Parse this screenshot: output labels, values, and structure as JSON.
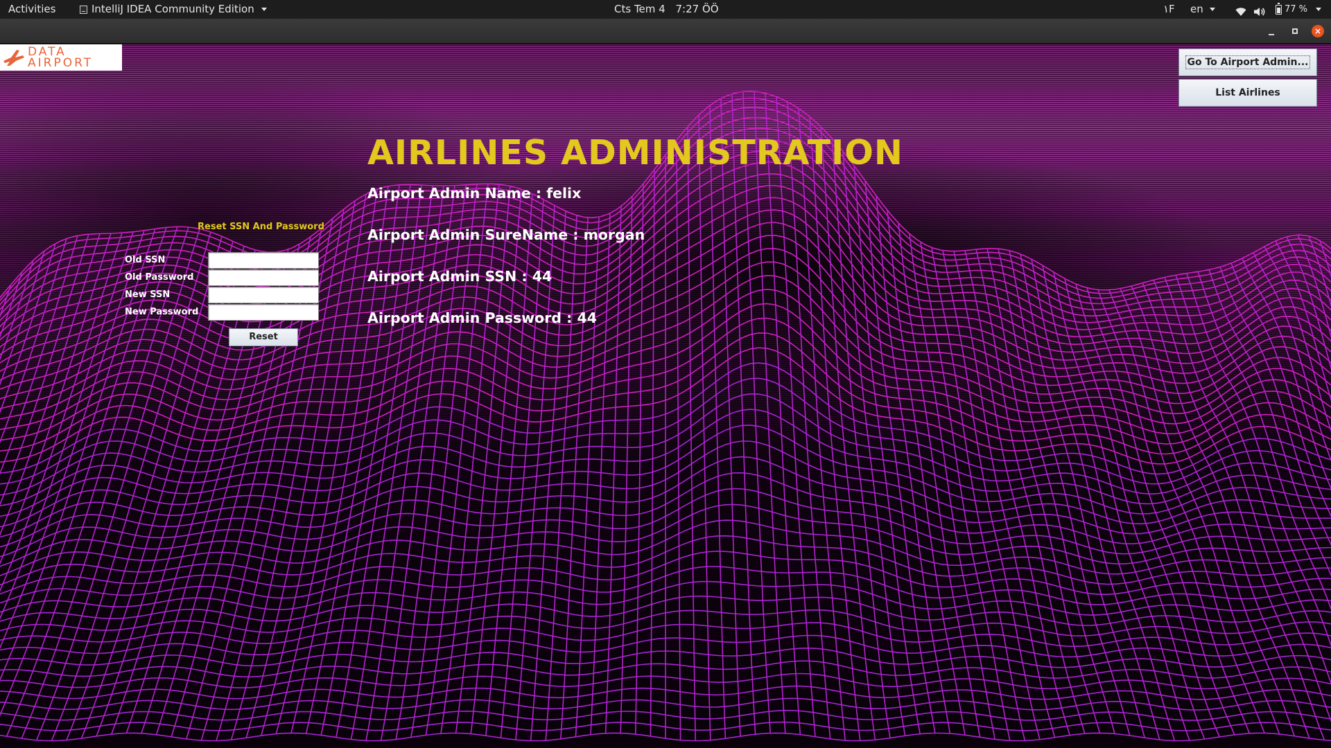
{
  "topbar": {
    "activities": "Activities",
    "app_name": "IntelliJ IDEA Community Edition",
    "date": "Cts Tem 4",
    "time": "7:27 ÖÖ",
    "indicator_num": "۱F",
    "language": "en",
    "battery": "77 %"
  },
  "window": {
    "close_glyph": "×"
  },
  "logo": {
    "line1": "DATA",
    "line2": "AIRPORT"
  },
  "buttons": {
    "go_to_admin": "Go To Airport Admin...",
    "list_airlines": "List Airlines",
    "reset": "Reset"
  },
  "main": {
    "title": "AIRLINES ADMINISTRATION",
    "admin_name": "Airport Admin Name : felix",
    "admin_surename": "Airport Admin SureName : morgan",
    "admin_ssn": "Airport Admin SSN : 44",
    "admin_password": "Airport Admin Password : 44"
  },
  "reset_form": {
    "title": "Reset SSN And Password",
    "old_ssn_label": "Old SSN",
    "old_password_label": "Old Password",
    "new_ssn_label": "New SSN",
    "new_password_label": "New Password",
    "old_ssn_value": "",
    "old_password_value": "",
    "new_ssn_value": "",
    "new_password_value": ""
  },
  "colors": {
    "title_yellow": "#e3c81d",
    "mesh_magenta": "#d21fc0",
    "mesh_purple": "#9a22d8",
    "ubuntu_close": "#e95420"
  },
  "icons": [
    "app-icon",
    "wifi-icon",
    "volume-icon",
    "battery-icon",
    "minimize-icon",
    "maximize-icon",
    "close-icon",
    "airplane-icon"
  ]
}
